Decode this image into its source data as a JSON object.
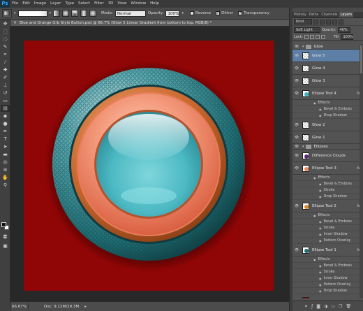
{
  "app": {
    "logo": "Ps"
  },
  "menu": [
    "File",
    "Edit",
    "Image",
    "Layer",
    "Type",
    "Select",
    "Filter",
    "3D",
    "View",
    "Window",
    "Help"
  ],
  "options_bar": {
    "mode_label": "Mode:",
    "mode_value": "Normal",
    "opacity_label": "Opacity:",
    "opacity_value": "100%",
    "reverse_label": "Reverse",
    "dither_label": "Dither",
    "transparency_label": "Transparency",
    "reverse_checked": false,
    "dither_checked": true,
    "transparency_checked": true
  },
  "document": {
    "tab_title": "Blue and Orange Orb Style Button.psd @ 66.7% (Glow 5    Linear Gradient from bottom to top, RGB/8) *",
    "background_color": "#900505"
  },
  "status": {
    "zoom": "66.67%",
    "doc_info": "Doc: 9.12M/29.3M"
  },
  "panel": {
    "tabs": [
      "History",
      "Paths",
      "Channels",
      "Layers"
    ],
    "active_tab": "Layers",
    "filter_value": "Kind",
    "blend_mode": "Soft Light",
    "opacity_label": "Opacity:",
    "opacity_value": "40%",
    "lock_label": "Lock:",
    "fill_label": "Fill:",
    "fill_value": "100%"
  },
  "layers": [
    {
      "type": "group",
      "name": "Glow"
    },
    {
      "type": "layer",
      "name": "Glow 5",
      "selected": true,
      "thumb": "checker"
    },
    {
      "type": "layer",
      "name": "Glow 4",
      "thumb": "checker"
    },
    {
      "type": "layer",
      "name": "Glow 3",
      "thumb": "checker"
    },
    {
      "type": "layer",
      "name": "Ellipse Tool 4",
      "fx": true,
      "thumb": "dot",
      "dot_color": "#3ab5c1"
    },
    {
      "type": "effects",
      "name": "Effects"
    },
    {
      "type": "effect",
      "name": "Bevel & Emboss"
    },
    {
      "type": "effect",
      "name": "Drop Shadow"
    },
    {
      "type": "layer",
      "name": "Glow 2",
      "thumb": "checker"
    },
    {
      "type": "layer",
      "name": "Glow 1",
      "thumb": "checker"
    },
    {
      "type": "group",
      "name": "Ellipses"
    },
    {
      "type": "layer",
      "name": "Difference Clouds",
      "thumb": "dot",
      "dot_color": "#5a2a7a"
    },
    {
      "type": "layer",
      "name": "Ellipse Tool 3",
      "fx": true,
      "thumb": "dot",
      "dot_color": "#ef8a5c"
    },
    {
      "type": "effects",
      "name": "Effects"
    },
    {
      "type": "effect",
      "name": "Bevel & Emboss"
    },
    {
      "type": "effect",
      "name": "Stroke"
    },
    {
      "type": "effect",
      "name": "Drop Shadow"
    },
    {
      "type": "layer",
      "name": "Ellipse Tool 2",
      "fx": true,
      "thumb": "dot",
      "dot_color": "#e3872b"
    },
    {
      "type": "effects",
      "name": "Effects"
    },
    {
      "type": "effect",
      "name": "Bevel & Emboss"
    },
    {
      "type": "effect",
      "name": "Stroke"
    },
    {
      "type": "effect",
      "name": "Inner Shadow"
    },
    {
      "type": "effect",
      "name": "Pattern Overlay"
    },
    {
      "type": "layer",
      "name": "Ellipse Tool 1",
      "fx": true,
      "thumb": "dot",
      "dot_color": "#1e6e72"
    },
    {
      "type": "effects",
      "name": "Effects"
    },
    {
      "type": "effect",
      "name": "Bevel & Emboss"
    },
    {
      "type": "effect",
      "name": "Stroke"
    },
    {
      "type": "effect",
      "name": "Inner Shadow"
    },
    {
      "type": "effect",
      "name": "Pattern Overlay"
    },
    {
      "type": "effect",
      "name": "Drop Shadow"
    },
    {
      "type": "layer",
      "name": "Background",
      "thumb": "solid",
      "dot_color": "#900505",
      "locked": true
    }
  ],
  "colors": {
    "accent_selected": "#5d7fa6",
    "ui_dark": "#535353",
    "canvas_bg": "#282828"
  }
}
